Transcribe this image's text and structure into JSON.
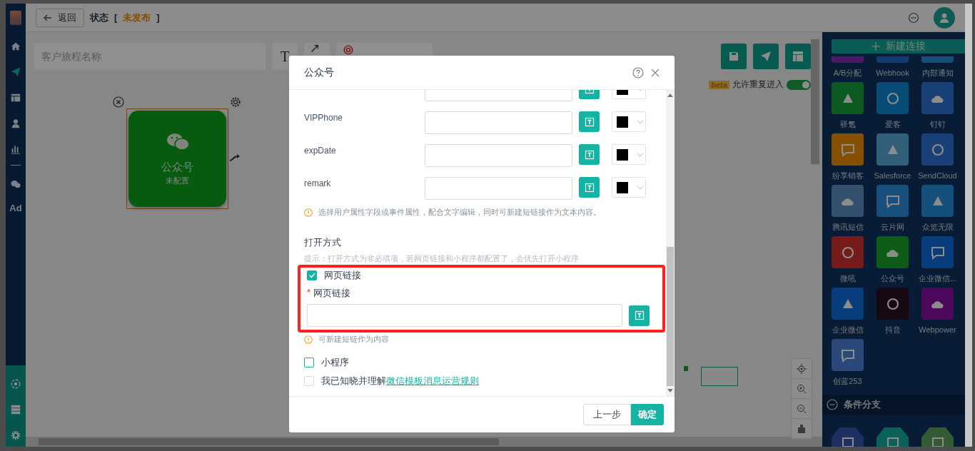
{
  "header": {
    "back_button": "返回",
    "status_label": "状态",
    "status_open": "[",
    "status_value": "未发布",
    "status_close": "]"
  },
  "sidebar": {
    "items": [
      {
        "selected": false
      },
      {
        "selected": true
      },
      {
        "selected": false
      },
      {
        "selected": false
      },
      {
        "selected": false
      },
      {
        "selected": false
      },
      {
        "label": "Ad",
        "selected": false
      }
    ]
  },
  "toolbar": {
    "name_placeholder": "客户旅程名称",
    "text_button": "T"
  },
  "canvas": {
    "beta_tag": "beta",
    "repeat_entry_label": "允许重复进入",
    "repeat_entry_on": true,
    "node": {
      "title": "公众号",
      "status": "未配置"
    }
  },
  "connector_panel": {
    "new_button": "新建连接",
    "items": [
      {
        "label": "A/B分配",
        "color": "#4c186a"
      },
      {
        "label": "Webhook",
        "color": "#0e3d72"
      },
      {
        "label": "内部通知",
        "color": "#174f7b"
      },
      {
        "label": "驿氪",
        "color": "#0d5a20"
      },
      {
        "label": "爱客",
        "color": "#074c77"
      },
      {
        "label": "钉钉",
        "color": "#194077"
      },
      {
        "label": "纷享销客",
        "color": "#865000"
      },
      {
        "label": "Salesforce",
        "color": "#32607a"
      },
      {
        "label": "SendCloud",
        "color": "#194077"
      },
      {
        "label": "腾讯短信",
        "color": "#34506c"
      },
      {
        "label": "云片网",
        "color": "#194f7c"
      },
      {
        "label": "众览无限",
        "color": "#154f7b"
      },
      {
        "label": "微吼",
        "color": "#761a1a"
      },
      {
        "label": "公众号",
        "color": "#0f5b18"
      },
      {
        "label": "企业微信...",
        "color": "#073d7c"
      },
      {
        "label": "企业微信",
        "color": "#073d7c"
      },
      {
        "label": "抖音",
        "color": "#170813"
      },
      {
        "label": "Webpower",
        "color": "#4c095c"
      },
      {
        "label": "创蓝253",
        "color": "#2a4879"
      }
    ],
    "section": {
      "title": "条件分支",
      "expanded": true
    },
    "section_items": [
      {
        "color": "#1d3061"
      },
      {
        "color": "#0a625a"
      },
      {
        "color": "#345b34"
      }
    ]
  },
  "dialog": {
    "title": "公众号",
    "fields": [
      {
        "color": "#000000"
      },
      {
        "label": "VIPPhone",
        "color": "#000000"
      },
      {
        "label": "expDate",
        "color": "#000000"
      },
      {
        "label": "remark",
        "color": "#000000"
      }
    ],
    "fields_hint": "选择用户属性字段或事件属性，配合文字编辑，同时可新建短链接作为文本内容。",
    "open_mode": {
      "title": "打开方式",
      "tip": "提示：打开方式为非必填项，若网页链接和小程序都配置了，会优先打开小程序",
      "options": [
        {
          "label": "网页链接",
          "checked": true,
          "highlighted": true,
          "required_mark": "*",
          "field_label": "网页链接",
          "hint": "可新建短链作为内容"
        },
        {
          "label": "小程序",
          "checked": false,
          "highlighted": false
        }
      ]
    },
    "agreement": {
      "text": "我已知晓并理解",
      "link": "微信模板消息运营规则",
      "checked": false
    },
    "buttons": {
      "back": "上一步",
      "confirm": "确定"
    }
  }
}
